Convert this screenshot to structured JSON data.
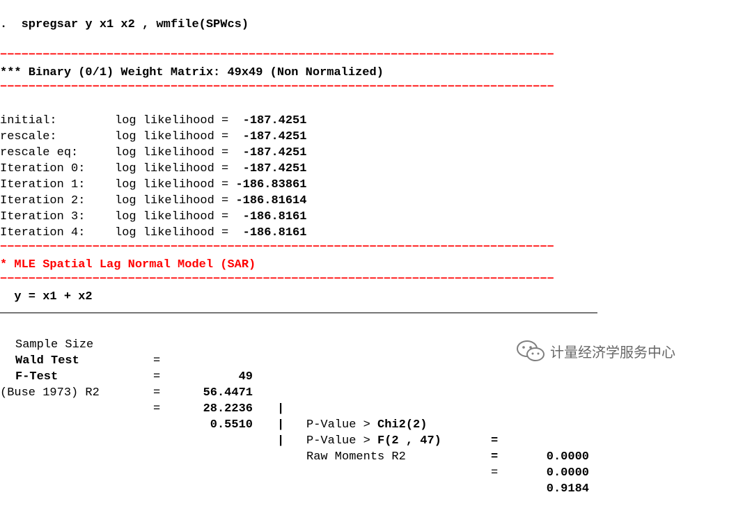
{
  "command": ".  spregsar y x1 x2 , wmfile(SPWcs)",
  "separator": "==============================================================================",
  "header_weight": "*** Binary (0/1) Weight Matrix: 49x49 (Non Normalized)",
  "iterations": [
    {
      "label": "initial:",
      "text": "log likelihood = ",
      "value": " -187.4251"
    },
    {
      "label": "rescale:",
      "text": "log likelihood = ",
      "value": " -187.4251"
    },
    {
      "label": "rescale eq:",
      "text": "log likelihood = ",
      "value": " -187.4251"
    },
    {
      "label": "Iteration 0:",
      "text": "log likelihood = ",
      "value": " -187.4251"
    },
    {
      "label": "Iteration 1:",
      "text": "log likelihood = ",
      "value": "-186.83861"
    },
    {
      "label": "Iteration 2:",
      "text": "log likelihood = ",
      "value": "-186.81614"
    },
    {
      "label": "Iteration 3:",
      "text": "log likelihood = ",
      "value": " -186.8161"
    },
    {
      "label": "Iteration 4:",
      "text": "log likelihood = ",
      "value": " -186.8161"
    }
  ],
  "model_title": "* MLE Spatial Lag Normal Model (SAR)",
  "equation": "  y = x1 + x2",
  "stats": {
    "sample_size_label": "Sample Size",
    "sample_size_value": "49",
    "wald_label": "Wald Test",
    "wald_value": "56.4471",
    "wald_p_label": "P-Value > ",
    "wald_p_dist": "Chi2(2)",
    "wald_p_value": "0.0000",
    "f_label": "F-Test",
    "f_value": "28.2236",
    "f_p_label": "P-Value > ",
    "f_p_dist": "F(2 , 47)",
    "f_p_value": "0.0000",
    "buse_label": "(Buse 1973) R2",
    "buse_value": "0.5510",
    "raw_label": "Raw Moments R2",
    "raw_value": "0.9184",
    "eq_sign": "=",
    "bar": "|"
  },
  "watermark": {
    "icon": "wechat-icon",
    "text": "计量经济学服务中心"
  },
  "colors": {
    "separator": "#ff0000",
    "model_title": "#ff0000",
    "text": "#000000"
  }
}
